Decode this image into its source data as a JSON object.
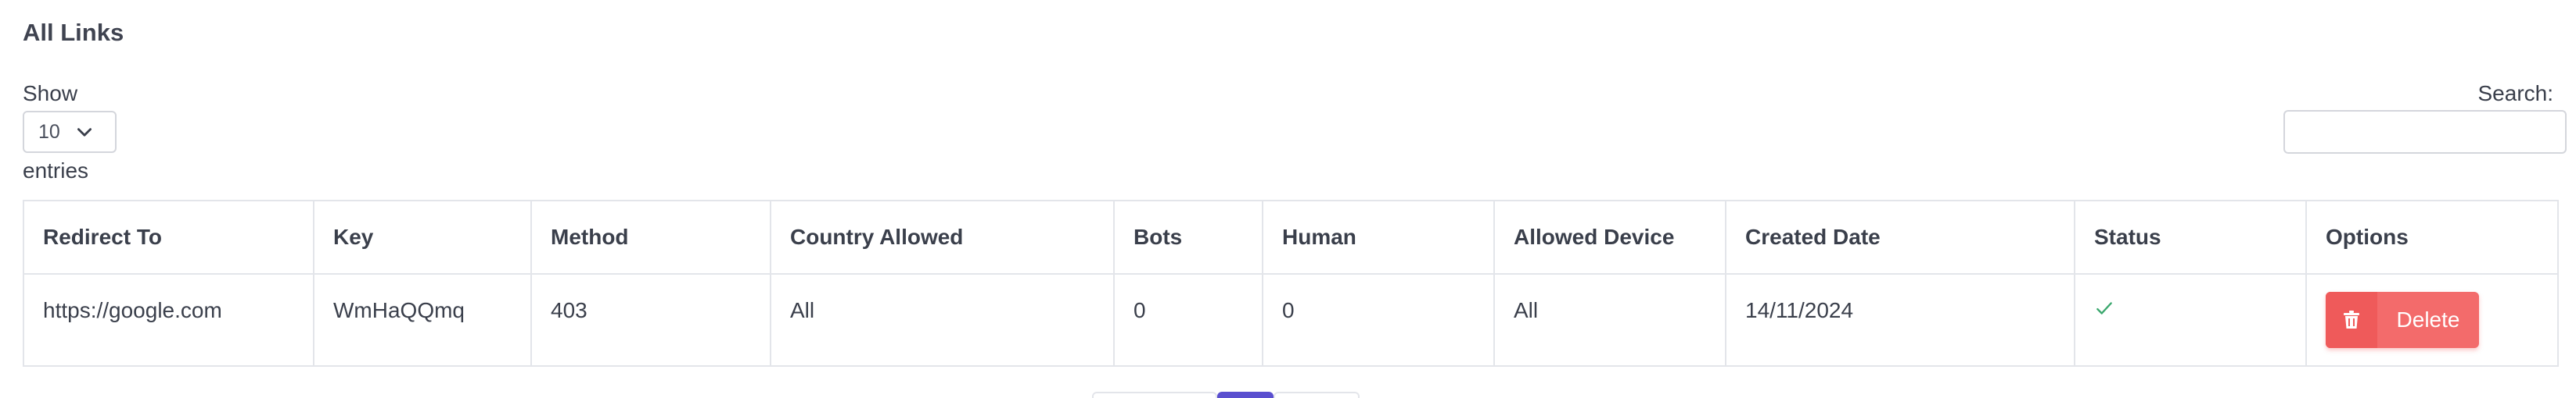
{
  "header": {
    "title": "All Links"
  },
  "length_control": {
    "show_label": "Show",
    "selected": "10",
    "entries_label": "entries"
  },
  "search": {
    "label": "Search:",
    "value": "",
    "placeholder": ""
  },
  "table": {
    "columns": [
      "Redirect To",
      "Key",
      "Method",
      "Country Allowed",
      "Bots",
      "Human",
      "Allowed Device",
      "Created Date",
      "Status",
      "Options"
    ],
    "rows": [
      {
        "redirect_to": "https://google.com",
        "key": "WmHaQQmq",
        "method": "403",
        "country_allowed": "All",
        "bots": "0",
        "human": "0",
        "allowed_device": "All",
        "created_date": "14/11/2024",
        "status_icon": "check-icon",
        "delete_label": "Delete"
      }
    ]
  },
  "icons": {
    "select": "chevron-down-icon",
    "delete": "trash-icon",
    "status": "check-icon"
  },
  "colors": {
    "delete_button": "#f36b6b",
    "status_ok": "#3aa76d",
    "pagination_active": "#5a4fcf"
  }
}
